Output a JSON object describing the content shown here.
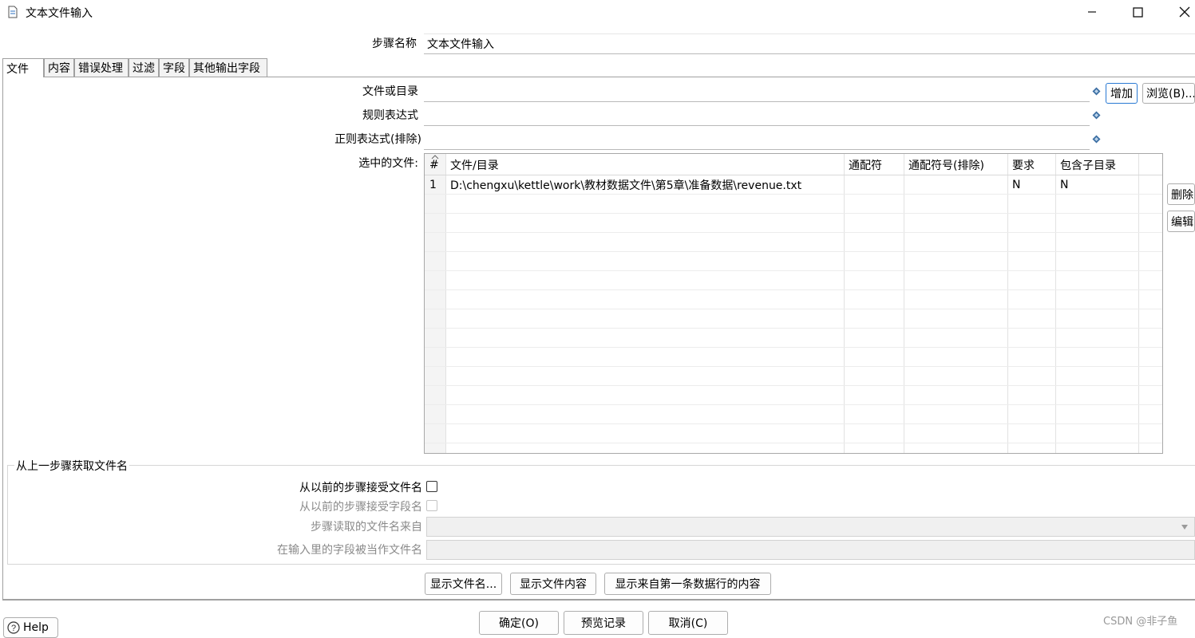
{
  "window": {
    "title": "文本文件输入"
  },
  "step_name": {
    "label": "步骤名称",
    "value": "文本文件输入"
  },
  "tabs": [
    {
      "label": "文件",
      "active": true
    },
    {
      "label": "内容"
    },
    {
      "label": "错误处理"
    },
    {
      "label": "过滤"
    },
    {
      "label": "字段"
    },
    {
      "label": "其他输出字段"
    }
  ],
  "file_tab": {
    "file_or_dir_label": "文件或目录",
    "file_or_dir_value": "",
    "regex_label": "规则表达式",
    "regex_value": "",
    "regex_exclude_label": "正则表达式(排除)",
    "regex_exclude_value": "",
    "add_button": "增加",
    "browse_button": "浏览(B)...",
    "selected_files_label": "选中的文件:",
    "delete_button": "删除",
    "edit_button": "编辑"
  },
  "table": {
    "headers": [
      "#",
      "文件/目录",
      "通配符",
      "通配符号(排除)",
      "要求",
      "包含子目录"
    ],
    "rows": [
      [
        "1",
        "D:\\chengxu\\kettle\\work\\教材数据文件\\第5章\\准备数据\\revenue.txt",
        "",
        "",
        "N",
        "N"
      ]
    ]
  },
  "prev_step_group": {
    "title": "从上一步骤获取文件名",
    "accept_filenames_label": "从以前的步骤接受文件名",
    "accept_fieldnames_label": "从以前的步骤接受字段名",
    "step_read_from_label": "步骤读取的文件名来自",
    "field_as_filename_label": "在输入里的字段被当作文件名"
  },
  "action_buttons": {
    "show_filenames": "显示文件名...",
    "show_file_content": "显示文件内容",
    "show_first_row_content": "显示来自第一条数据行的内容"
  },
  "footer": {
    "help": "Help",
    "ok": "确定(O)",
    "preview": "预览记录",
    "cancel": "取消(C)",
    "watermark": "CSDN @非子鱼"
  }
}
